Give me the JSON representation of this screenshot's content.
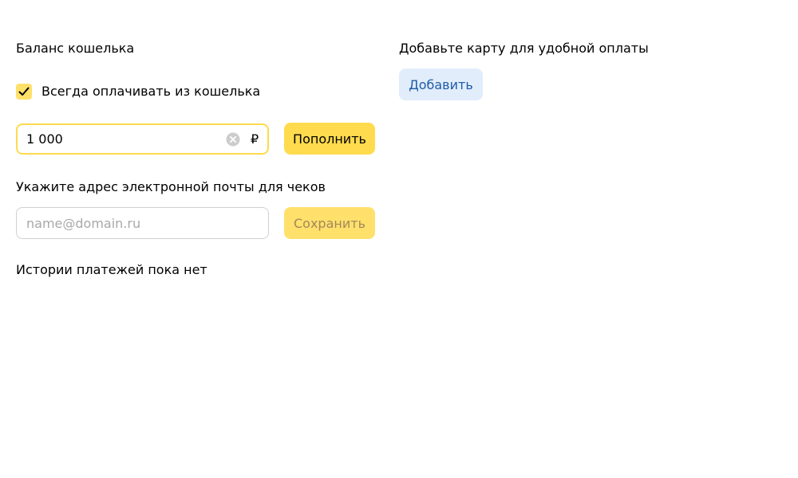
{
  "wallet": {
    "title": "Баланс кошелька",
    "always_pay_label": "Всегда оплачивать из кошелька",
    "always_pay_checked": true,
    "amount_value": "1 000",
    "currency": "₽",
    "topup_button": "Пополнить"
  },
  "receipts": {
    "title": "Укажите адрес электронной почты для чеков",
    "email_placeholder": "name@domain.ru",
    "email_value": "",
    "save_button": "Сохранить"
  },
  "history": {
    "empty_text": "Истории платежей пока нет"
  },
  "card": {
    "title": "Добавьте карту для удобной оплаты",
    "add_button": "Добавить"
  },
  "colors": {
    "primary_yellow": "#ffdb4d",
    "checkbox_yellow": "#ffe06b",
    "add_button_bg": "#e1edfb",
    "add_button_text": "#1f5ba8"
  }
}
